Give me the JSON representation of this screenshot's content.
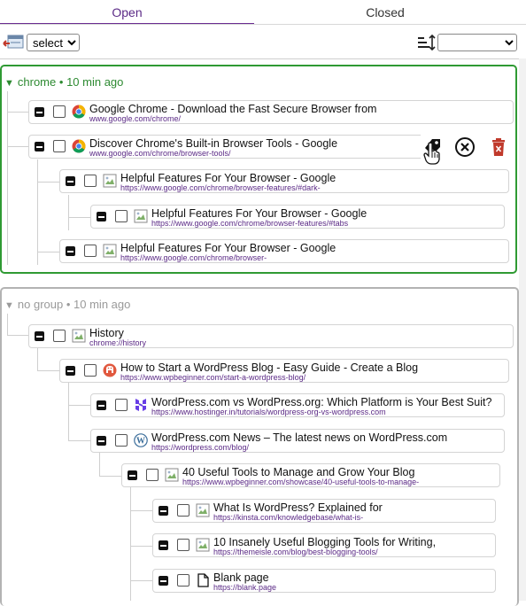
{
  "tabs": {
    "open": "Open",
    "closed": "Closed"
  },
  "toolbar": {
    "group_by": "select",
    "sort_value": ""
  },
  "colors": {
    "accent": "#6a2c91",
    "group_chrome": "#2f9a33",
    "group_none": "#b3b3b3",
    "url": "#5b2a86"
  },
  "groups": [
    {
      "name": "chrome",
      "time": "10 min ago",
      "tabs": [
        {
          "title": "Google Chrome - Download the Fast Secure Browser from",
          "url": "www.google.com/chrome/",
          "icon": "chrome-icon"
        },
        {
          "title": "Discover Chrome's Built-in Browser Tools - Google",
          "url": "www.google.com/chrome/browser-tools/",
          "icon": "chrome-icon"
        },
        {
          "title": "Helpful Features For Your Browser - Google",
          "url": "https://www.google.com/chrome/browser-features/#dark-",
          "icon": "broken-image-icon"
        },
        {
          "title": "Helpful Features For Your Browser - Google",
          "url": "https://www.google.com/chrome/browser-features/#tabs",
          "icon": "broken-image-icon"
        },
        {
          "title": "Helpful Features For Your Browser - Google",
          "url": "https://www.google.com/chrome/browser-",
          "icon": "broken-image-icon"
        }
      ]
    },
    {
      "name": "no group",
      "time": "10 min ago",
      "tabs": [
        {
          "title": "History",
          "url": "chrome://history",
          "icon": "broken-image-icon"
        },
        {
          "title": "How to Start a WordPress Blog - Easy Guide - Create a Blog",
          "url": "https://www.wpbeginner.com/start-a-wordpress-blog/",
          "icon": "wpbeginner-icon"
        },
        {
          "title": "WordPress.com vs WordPress.org: Which Platform is Your Best Suit?",
          "url": "https://www.hostinger.in/tutorials/wordpress-org-vs-wordpress.com",
          "icon": "hostinger-icon"
        },
        {
          "title": "WordPress.com News – The latest news on WordPress.com",
          "url": "https://wordpress.com/blog/",
          "icon": "wordpress-icon"
        },
        {
          "title": "40 Useful Tools to Manage and Grow Your Blog",
          "url": "https://www.wpbeginner.com/showcase/40-useful-tools-to-manage-",
          "icon": "broken-image-icon"
        },
        {
          "title": "What Is WordPress? Explained for",
          "url": "https://kinsta.com/knowledgebase/what-is-",
          "icon": "broken-image-icon"
        },
        {
          "title": "10 Insanely Useful Blogging Tools for Writing,",
          "url": "https://themeisle.com/blog/best-blogging-tools/",
          "icon": "broken-image-icon"
        },
        {
          "title": "Blank page",
          "url": "https://blank.page",
          "icon": "document-icon"
        }
      ]
    }
  ]
}
